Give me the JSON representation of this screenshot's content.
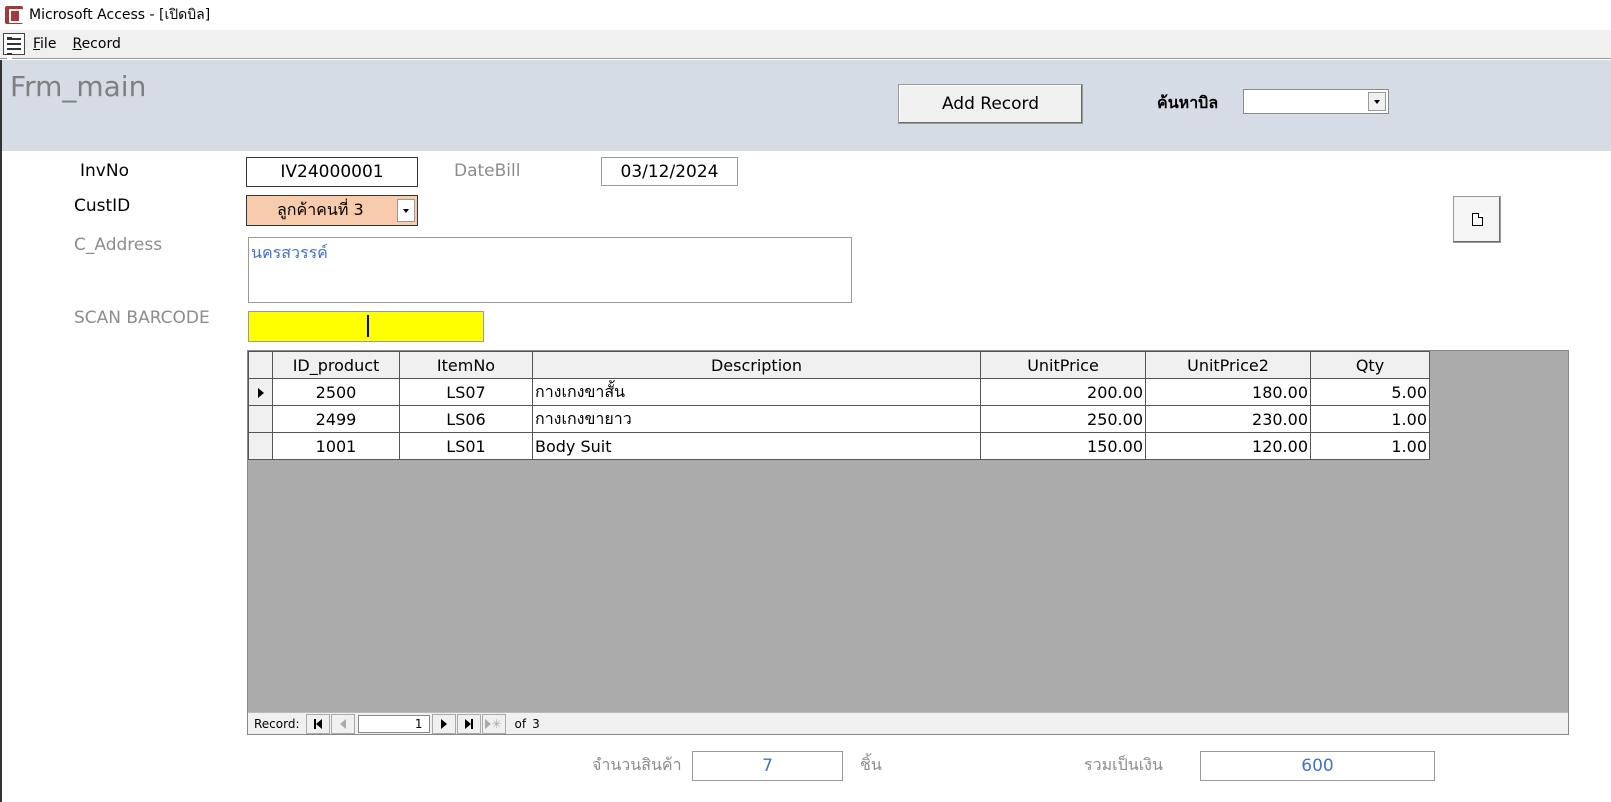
{
  "window": {
    "title": "Microsoft Access - [เปิดบิล]"
  },
  "menu": {
    "items": [
      "File",
      "Record"
    ]
  },
  "header": {
    "form_title": "Frm_main",
    "add_button": "Add Record",
    "search_label": "ค้นหาบิล",
    "search_value": ""
  },
  "fields": {
    "invno_label": "InvNo",
    "invno_value": "IV24000001",
    "datebill_label": "DateBill",
    "datebill_value": "03/12/2024",
    "custid_label": "CustID",
    "custid_value": "ลูกค้าคนที่ 3",
    "address_label": "C_Address",
    "address_value": "นครสวรรค์",
    "barcode_label": "SCAN BARCODE",
    "barcode_value": ""
  },
  "grid": {
    "columns": [
      "ID_product",
      "ItemNo",
      "Description",
      "UnitPrice",
      "UnitPrice2",
      "Qty"
    ],
    "rows": [
      [
        "2500",
        "LS07",
        "กางเกงขาสั้น",
        "200.00",
        "180.00",
        "5.00"
      ],
      [
        "2499",
        "LS06",
        "กางเกงขายาว",
        "250.00",
        "230.00",
        "1.00"
      ],
      [
        "1001",
        "LS01",
        "Body Suit",
        "150.00",
        "120.00",
        "1.00"
      ]
    ],
    "current_row": 0
  },
  "navigator": {
    "label": "Record:",
    "current": "1",
    "of_label": "of",
    "total": "3"
  },
  "footer": {
    "qty_label": "จำนวนสินค้า",
    "qty_value": "7",
    "unit_label": "ชิ้น",
    "sum_label": "รวมเป็นเงิน",
    "sum_value": "600"
  }
}
